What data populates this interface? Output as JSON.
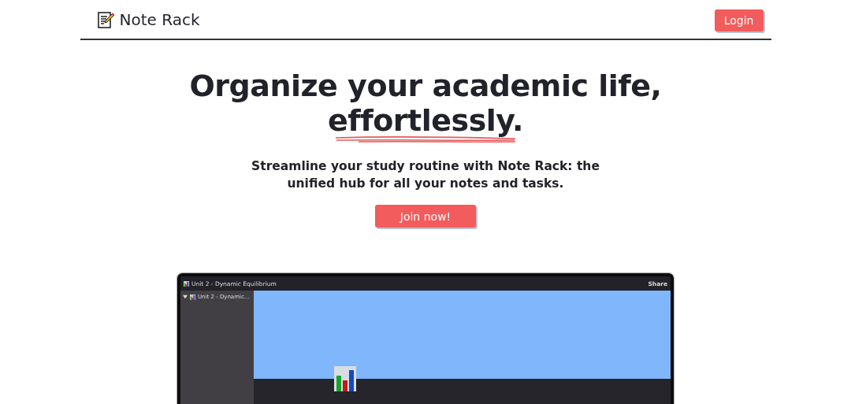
{
  "nav": {
    "brand": "Note Rack",
    "login": "Login"
  },
  "hero": {
    "headline": "Organize your academic life,",
    "emphasis": "effortlessly.",
    "subtitle": "Streamline your study routine with Note Rack: the unified hub for all your notes and tasks.",
    "cta": "Join now!"
  },
  "preview": {
    "window_title": "Unit 2 - Dynamic Equilibrium",
    "share": "Share",
    "tree": [
      {
        "label": "Unit 2 - Dynamic...",
        "expanded": true
      }
    ]
  }
}
